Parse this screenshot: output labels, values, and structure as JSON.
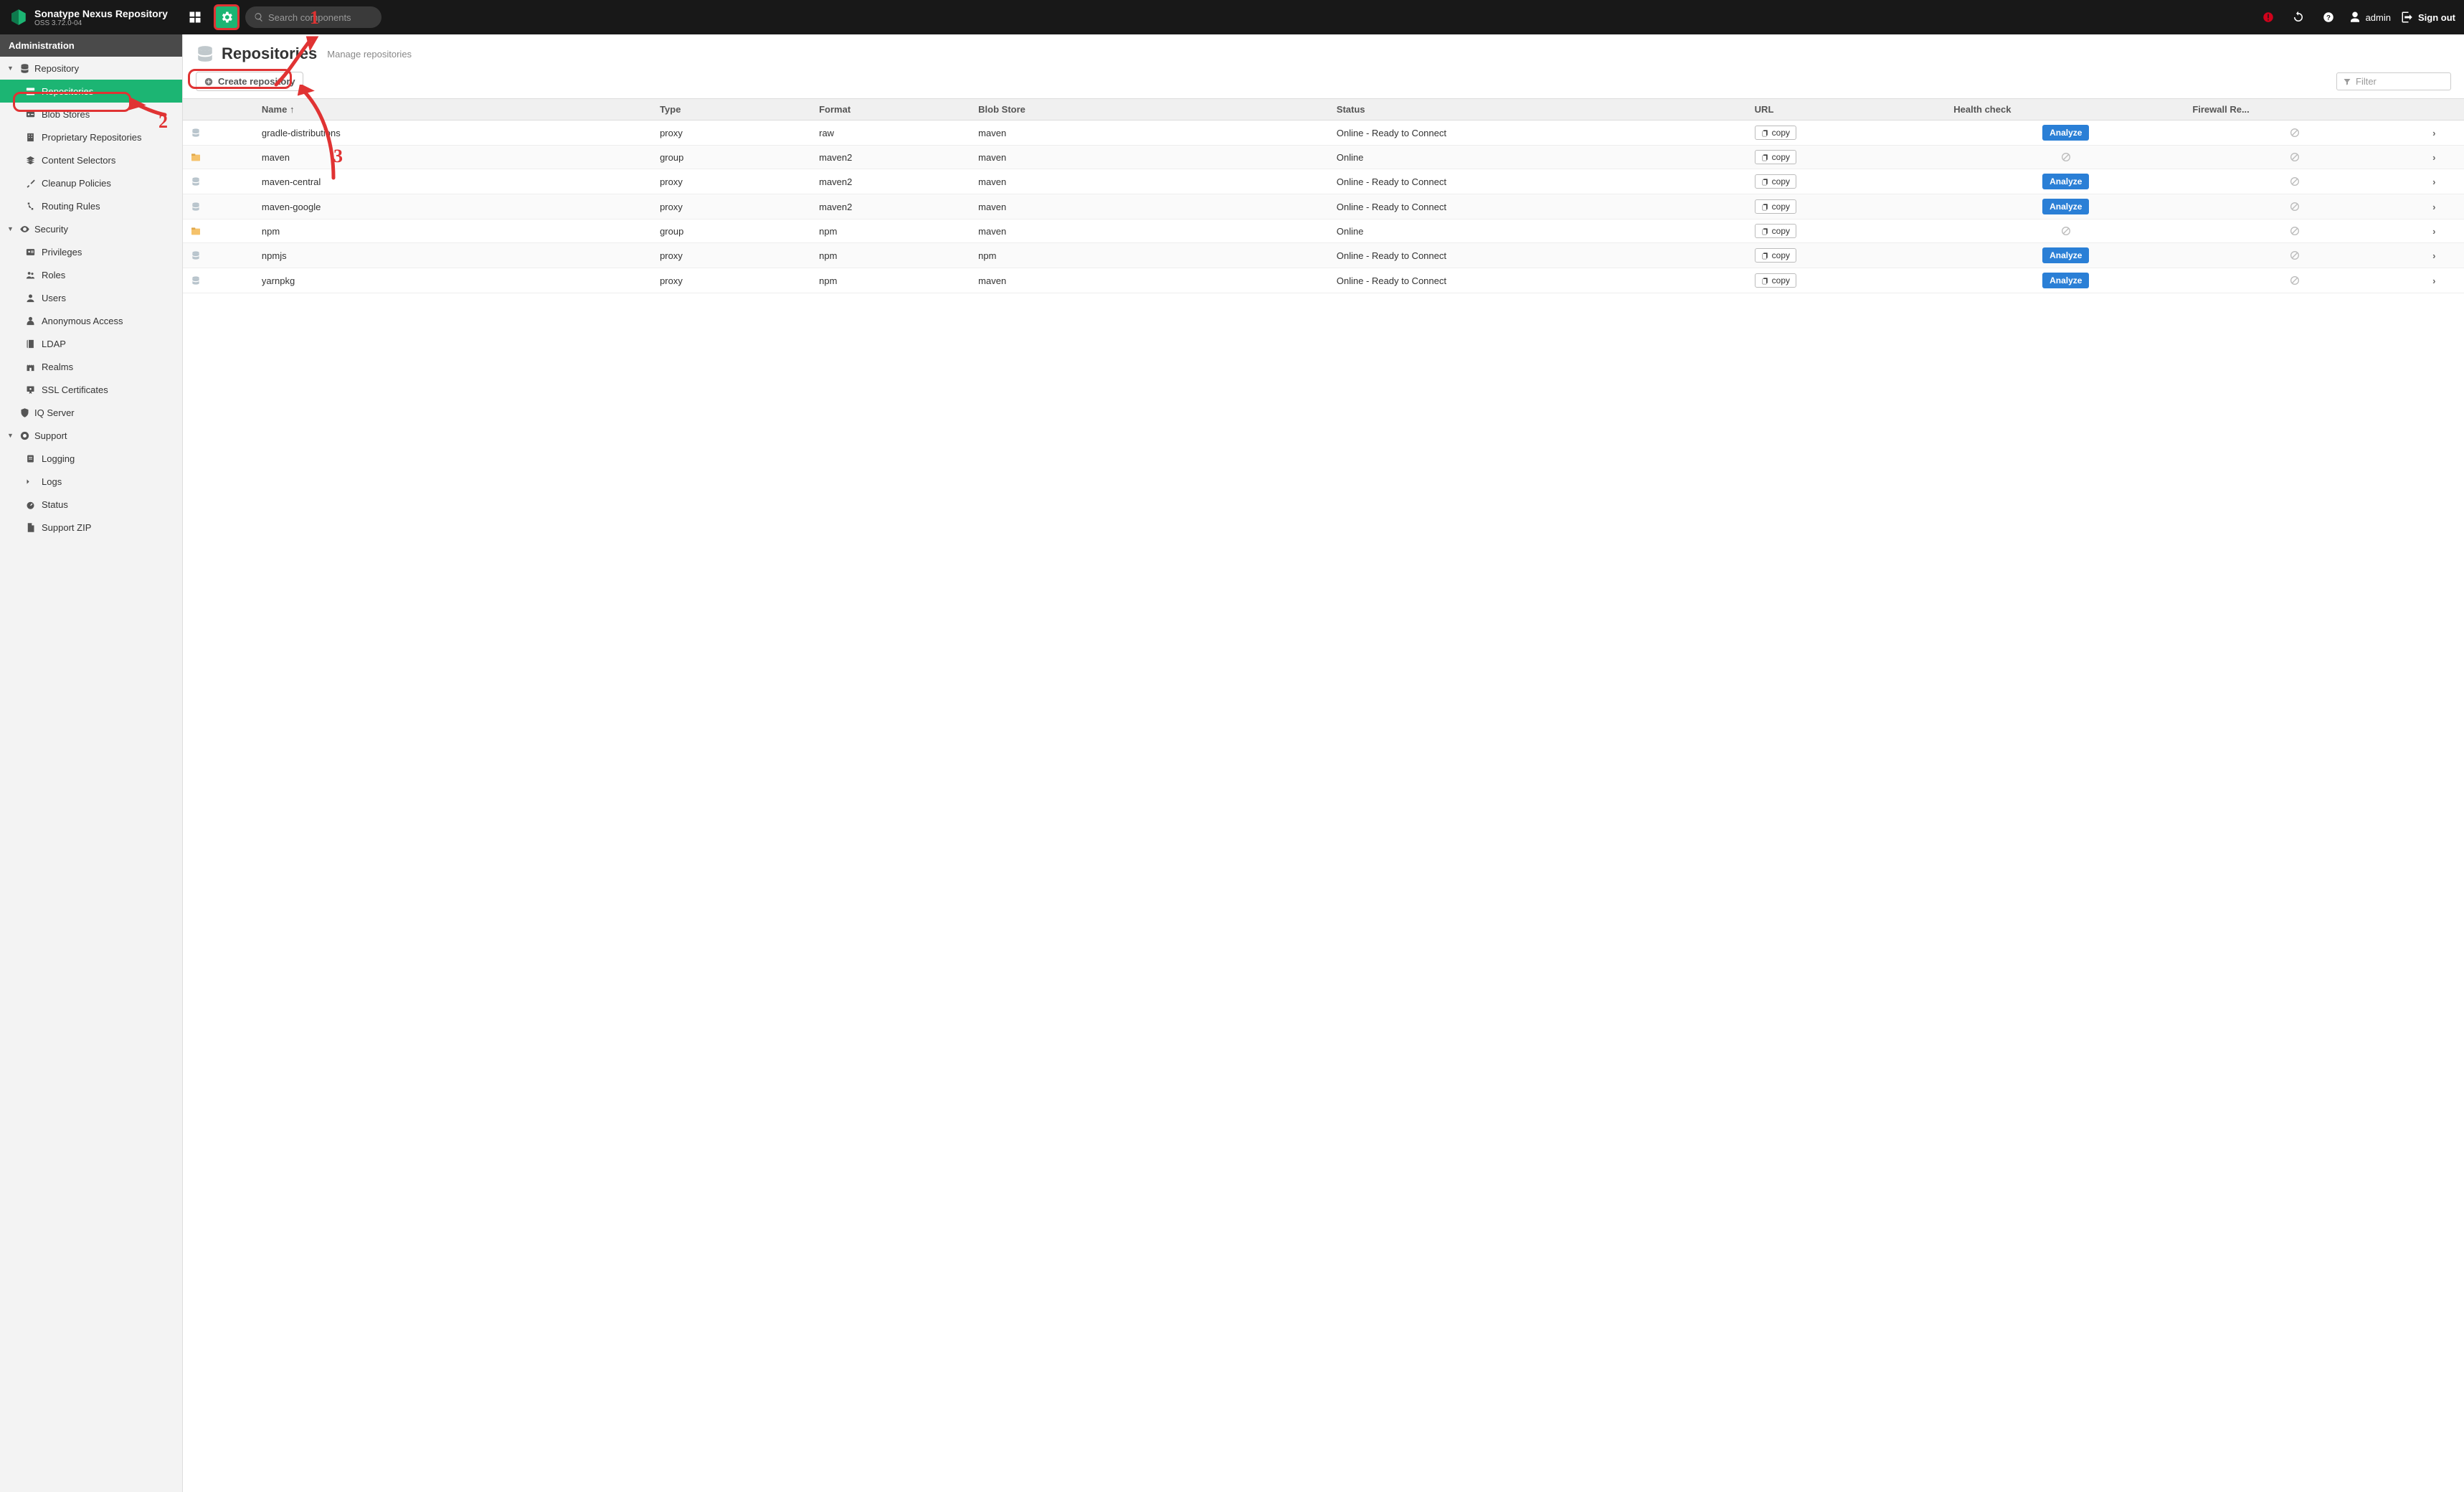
{
  "brand": {
    "title": "Sonatype Nexus Repository",
    "subtitle": "OSS 3.72.0-04"
  },
  "topbar": {
    "search_placeholder": "Search components",
    "user": "admin",
    "signout": "Sign out"
  },
  "sidebar": {
    "header": "Administration",
    "groups": [
      {
        "label": "Repository",
        "icon": "database-icon",
        "expanded": true,
        "items": [
          {
            "label": "Repositories",
            "icon": "server-icon",
            "active": true
          },
          {
            "label": "Blob Stores",
            "icon": "hdd-icon"
          },
          {
            "label": "Proprietary Repositories",
            "icon": "building-icon"
          },
          {
            "label": "Content Selectors",
            "icon": "layers-icon"
          },
          {
            "label": "Cleanup Policies",
            "icon": "brush-icon"
          },
          {
            "label": "Routing Rules",
            "icon": "route-icon"
          }
        ]
      },
      {
        "label": "Security",
        "icon": "eye-icon",
        "expanded": true,
        "items": [
          {
            "label": "Privileges",
            "icon": "id-card-icon"
          },
          {
            "label": "Roles",
            "icon": "users-icon"
          },
          {
            "label": "Users",
            "icon": "user-icon"
          },
          {
            "label": "Anonymous Access",
            "icon": "person-icon"
          },
          {
            "label": "LDAP",
            "icon": "book-icon"
          },
          {
            "label": "Realms",
            "icon": "castle-icon"
          },
          {
            "label": "SSL Certificates",
            "icon": "certificate-icon"
          }
        ]
      },
      {
        "label": "IQ Server",
        "icon": "shield-icon",
        "expanded": false,
        "items": []
      },
      {
        "label": "Support",
        "icon": "lifebuoy-icon",
        "expanded": true,
        "items": [
          {
            "label": "Logging",
            "icon": "scroll-icon"
          },
          {
            "label": "Logs",
            "icon": "terminal-icon"
          },
          {
            "label": "Status",
            "icon": "dashboard-icon"
          },
          {
            "label": "Support ZIP",
            "icon": "file-icon"
          }
        ]
      }
    ]
  },
  "page": {
    "title": "Repositories",
    "subtitle": "Manage repositories",
    "create_label": "Create repository",
    "filter_placeholder": "Filter",
    "columns": {
      "name": "Name",
      "type": "Type",
      "format": "Format",
      "blob": "Blob Store",
      "status": "Status",
      "url": "URL",
      "hc": "Health check",
      "fw": "Firewall Re..."
    },
    "copy_label": "copy",
    "analyze_label": "Analyze",
    "rows": [
      {
        "name": "gradle-distributions",
        "type": "proxy",
        "format": "raw",
        "blob": "maven",
        "status": "Online - Ready to Connect",
        "hc": "analyze",
        "fw": "disabled",
        "icon": "proxy"
      },
      {
        "name": "maven",
        "type": "group",
        "format": "maven2",
        "blob": "maven",
        "status": "Online",
        "hc": "disabled",
        "fw": "disabled",
        "icon": "group"
      },
      {
        "name": "maven-central",
        "type": "proxy",
        "format": "maven2",
        "blob": "maven",
        "status": "Online - Ready to Connect",
        "hc": "analyze",
        "fw": "disabled",
        "icon": "proxy"
      },
      {
        "name": "maven-google",
        "type": "proxy",
        "format": "maven2",
        "blob": "maven",
        "status": "Online - Ready to Connect",
        "hc": "analyze",
        "fw": "disabled",
        "icon": "proxy"
      },
      {
        "name": "npm",
        "type": "group",
        "format": "npm",
        "blob": "maven",
        "status": "Online",
        "hc": "disabled",
        "fw": "disabled",
        "icon": "group"
      },
      {
        "name": "npmjs",
        "type": "proxy",
        "format": "npm",
        "blob": "npm",
        "status": "Online - Ready to Connect",
        "hc": "analyze",
        "fw": "disabled",
        "icon": "proxy"
      },
      {
        "name": "yarnpkg",
        "type": "proxy",
        "format": "npm",
        "blob": "maven",
        "status": "Online - Ready to Connect",
        "hc": "analyze",
        "fw": "disabled",
        "icon": "proxy"
      }
    ]
  },
  "annotations": {
    "one": "1",
    "two": "2",
    "three": "3"
  }
}
